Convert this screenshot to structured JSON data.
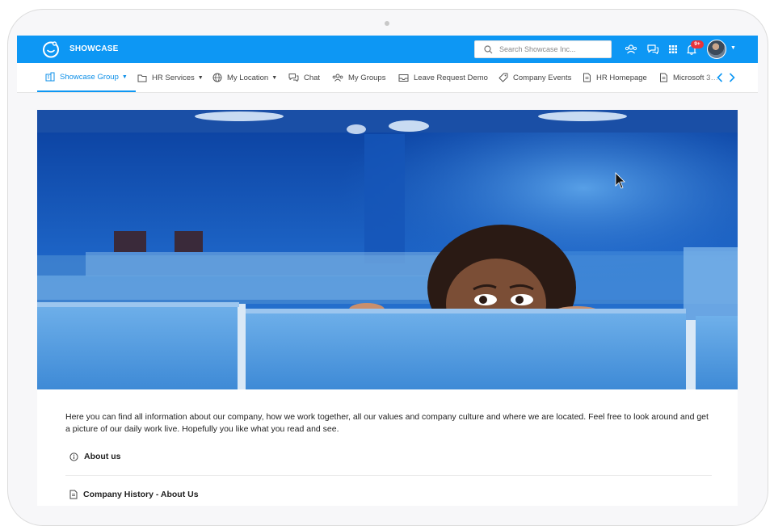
{
  "app": {
    "brand": "SHOWCASE",
    "accent_color": "#0d97f4",
    "search": {
      "placeholder": "Search Showcase Inc...",
      "value": ""
    },
    "notifications_badge": "9+",
    "icons": [
      "logo-icon",
      "search-icon",
      "people-icon",
      "chat-icon",
      "apps-grid-icon",
      "bell-icon",
      "avatar",
      "chevron-down-icon"
    ]
  },
  "nav": {
    "items": [
      {
        "label": "Showcase Group",
        "icon": "building-icon",
        "dropdown": true,
        "active": true
      },
      {
        "label": "HR Services",
        "icon": "folder-icon",
        "dropdown": true
      },
      {
        "label": "My Location",
        "icon": "globe-icon",
        "dropdown": true
      },
      {
        "label": "Chat",
        "icon": "chat-icon"
      },
      {
        "label": "My Groups",
        "icon": "groups-icon"
      },
      {
        "label": "Leave Request Demo",
        "icon": "inbox-icon"
      },
      {
        "label": "Company Events",
        "icon": "tag-icon"
      },
      {
        "label": "HR Homepage",
        "icon": "page-icon"
      },
      {
        "label": "Microsoft 3…",
        "icon": "page-icon"
      }
    ]
  },
  "page": {
    "intro": "Here you can find all information about our company, how we work together, all our values and company culture and where we are located. Feel free to look around and get a picture of our daily work live. Hopefully you like what you read and see.",
    "sections": [
      {
        "label": "About us",
        "icon": "info-icon"
      },
      {
        "label": "Company History - About Us",
        "icon": "document-icon"
      }
    ]
  }
}
